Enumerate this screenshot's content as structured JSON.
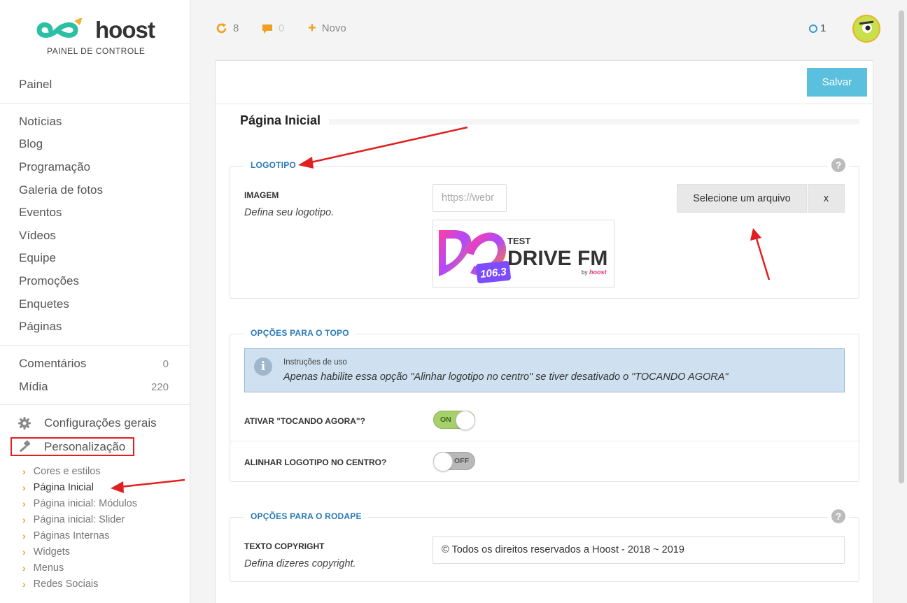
{
  "brand": {
    "logo_text": "hoost",
    "subtitle": "PAINEL DE CONTROLE"
  },
  "sidebar": {
    "painel": "Painel",
    "content_items": [
      "Notícias",
      "Blog",
      "Programação",
      "Galeria de fotos",
      "Eventos",
      "Vídeos",
      "Equipe",
      "Promoções",
      "Enquetes",
      "Páginas"
    ],
    "comentarios": {
      "label": "Comentários",
      "count": "0"
    },
    "midia": {
      "label": "Mídia",
      "count": "220"
    },
    "config": "Configurações gerais",
    "personalizacao": "Personalização",
    "sub_items": [
      "Cores e estilos",
      "Página Inicial",
      "Página inicial: Módulos",
      "Página inicial: Slider",
      "Páginas Internas",
      "Widgets",
      "Menus",
      "Redes Sociais"
    ],
    "active_sub": "Página Inicial"
  },
  "topbar": {
    "updates": "8",
    "comments": "0",
    "new_label": "Novo",
    "notifications": "1"
  },
  "page": {
    "save_label": "Salvar",
    "title": "Página Inicial",
    "logo_section": {
      "legend": "LOGOTIPO",
      "label": "IMAGEM",
      "desc": "Defina seu logotipo.",
      "url_value": "https://webr",
      "select_btn": "Selecione um arquivo",
      "clear_btn": "x",
      "preview": {
        "top": "TEST",
        "main": "DRIVE FM",
        "freq": "106.3",
        "by": "by",
        "by_brand": "hoost"
      }
    },
    "top_section": {
      "legend": "OPÇÕES PARA O TOPO",
      "info_title": "Instruções de uso",
      "info_text": "Apenas habilite essa opção \"Alinhar logotipo no centro\" se tiver desativado o \"TOCANDO AGORA\"",
      "opt1_label": "ATIVAR \"TOCANDO AGORA\"?",
      "opt1_state": "ON",
      "opt2_label": "ALINHAR LOGOTIPO NO CENTRO?",
      "opt2_state": "OFF"
    },
    "footer_section": {
      "legend": "OPÇÕES PARA O RODAPE",
      "label": "TEXTO COPYRIGHT",
      "desc": "Defina dizeres copyright.",
      "value": "© Todos os direitos reservados a Hoost - 2018 ~ 2019"
    }
  },
  "colors": {
    "accent": "#5bc0de",
    "legend": "#2a7ab8",
    "warning": "#f0a020",
    "annotation": "#e02020",
    "toggle_on": "#a7cf6e"
  }
}
